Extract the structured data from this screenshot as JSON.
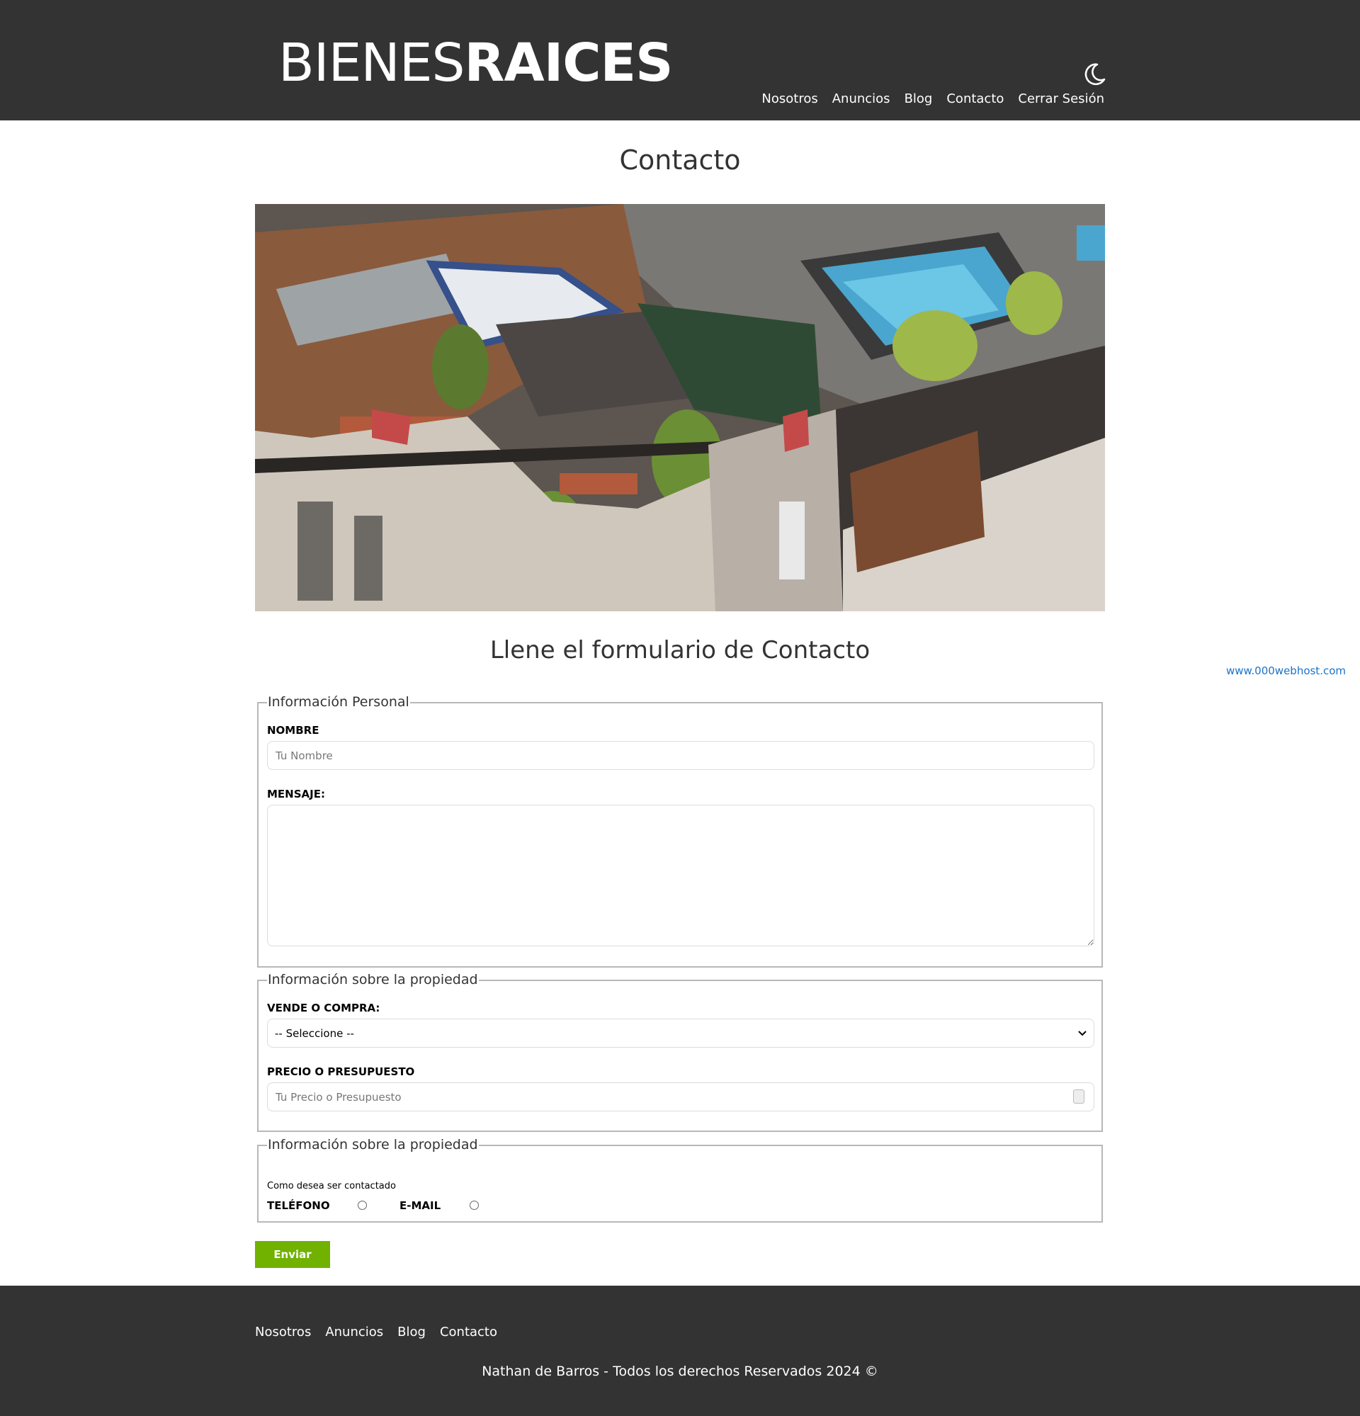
{
  "header": {
    "logo_light": "BIENES",
    "logo_bold": "RAICES",
    "theme_icon": "moon-icon",
    "nav": [
      "Nosotros",
      "Anuncios",
      "Blog",
      "Contacto",
      "Cerrar Sesión"
    ]
  },
  "main": {
    "title": "Contacto",
    "form_title": "Llene el formulario de Contacto",
    "host_link": "www.000webhost.com"
  },
  "form": {
    "personal": {
      "legend": "Información Personal",
      "name_label": "Nombre",
      "name_placeholder": "Tu Nombre",
      "message_label": "Mensaje:"
    },
    "property": {
      "legend": "Información sobre la propiedad",
      "type_label": "Vende o Compra:",
      "type_selected": "-- Seleccione --",
      "price_label": "Precio o Presupuesto",
      "price_placeholder": "Tu Precio o Presupuesto"
    },
    "contact": {
      "legend": "Información sobre la propiedad",
      "prompt": "Como desea ser contactado",
      "option_phone": "Teléfono",
      "option_email": "E-mail"
    },
    "submit": "Enviar"
  },
  "footer": {
    "nav": [
      "Nosotros",
      "Anuncios",
      "Blog",
      "Contacto"
    ],
    "copyright": "Nathan de Barros - Todos los derechos Reservados 2024 ©"
  },
  "colors": {
    "header_bg": "#333333",
    "accent_green": "#71b100",
    "link_blue": "#1a73c9"
  }
}
